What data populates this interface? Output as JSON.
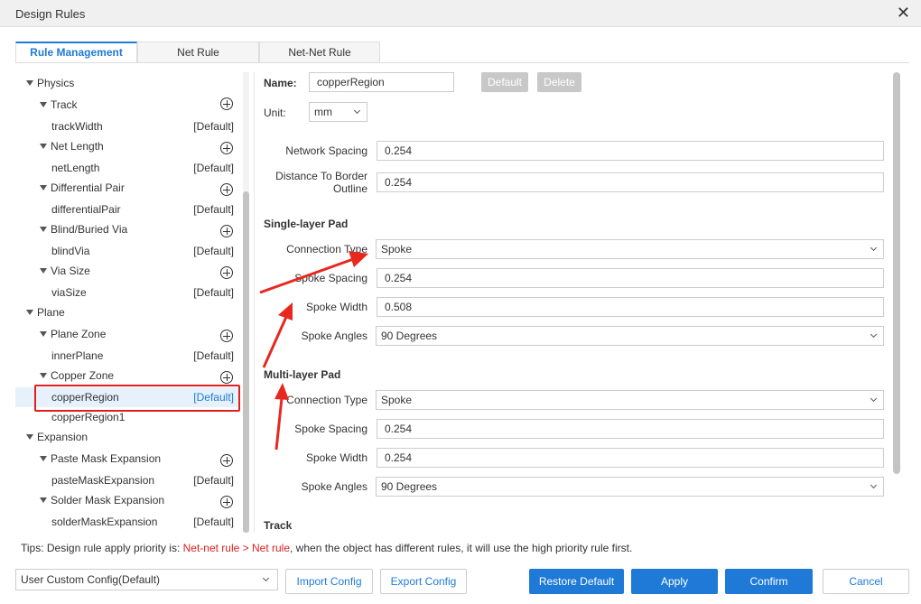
{
  "window": {
    "title": "Design Rules",
    "close_glyph": "✕"
  },
  "tabs": [
    {
      "label": "Rule Management",
      "active": true
    },
    {
      "label": "Net Rule",
      "active": false
    },
    {
      "label": "Net-Net Rule",
      "active": false
    }
  ],
  "tree": {
    "default_tag": "[Default]",
    "physics": "Physics",
    "track": "Track",
    "trackWidth": "trackWidth",
    "netLength": "Net Length",
    "netLengthItem": "netLength",
    "diffPair": "Differential Pair",
    "diffPairItem": "differentialPair",
    "blindVia": "Blind/Buried Via",
    "blindViaItem": "blindVia",
    "viaSize": "Via Size",
    "viaSizeItem": "viaSize",
    "plane": "Plane",
    "planeZone": "Plane Zone",
    "innerPlane": "innerPlane",
    "copperZone": "Copper Zone",
    "copperRegion": "copperRegion",
    "copperRegion1": "copperRegion1",
    "expansion": "Expansion",
    "pasteMask": "Paste Mask Expansion",
    "pasteMaskItem": "pasteMaskExpansion",
    "solderMask": "Solder Mask Expansion",
    "solderMaskItem": "solderMaskExpansion"
  },
  "form": {
    "name_label": "Name:",
    "name_value": "copperRegion",
    "default_button": "Default",
    "delete_button": "Delete",
    "unit_label": "Unit:",
    "unit_value": "mm",
    "network_spacing_label": "Network Spacing",
    "network_spacing_value": "0.254",
    "border_label_line1": "Distance To Border",
    "border_label_line2": "Outline",
    "border_value": "0.254",
    "single_pad": {
      "title": "Single-layer Pad",
      "connection_type_label": "Connection Type",
      "connection_type": "Spoke",
      "spoke_spacing_label": "Spoke Spacing",
      "spoke_spacing": "0.254",
      "spoke_width_label": "Spoke Width",
      "spoke_width": "0.508",
      "spoke_angles_label": "Spoke Angles",
      "spoke_angles": "90 Degrees"
    },
    "multi_pad": {
      "title": "Multi-layer Pad",
      "connection_type_label": "Connection Type",
      "connection_type": "Spoke",
      "spoke_spacing_label": "Spoke Spacing",
      "spoke_spacing": "0.254",
      "spoke_width_label": "Spoke Width",
      "spoke_width": "0.254",
      "spoke_angles_label": "Spoke Angles",
      "spoke_angles": "90 Degrees"
    },
    "track_title": "Track"
  },
  "tips": {
    "prefix": "Tips: Design rule apply priority is: ",
    "priority": "Net-net rule > Net rule",
    "suffix": ", when the object has different rules, it will use the high priority rule first."
  },
  "footer": {
    "config_value": "User Custom Config(Default)",
    "import": "Import Config",
    "export": "Export Config",
    "restore": "Restore Default",
    "apply": "Apply",
    "confirm": "Confirm",
    "cancel": "Cancel"
  },
  "colors": {
    "accent": "#1e7ad6",
    "highlight_red": "#e02020",
    "disabled_gray": "#c8c8c8",
    "selected_bg": "#e6f1fc"
  }
}
